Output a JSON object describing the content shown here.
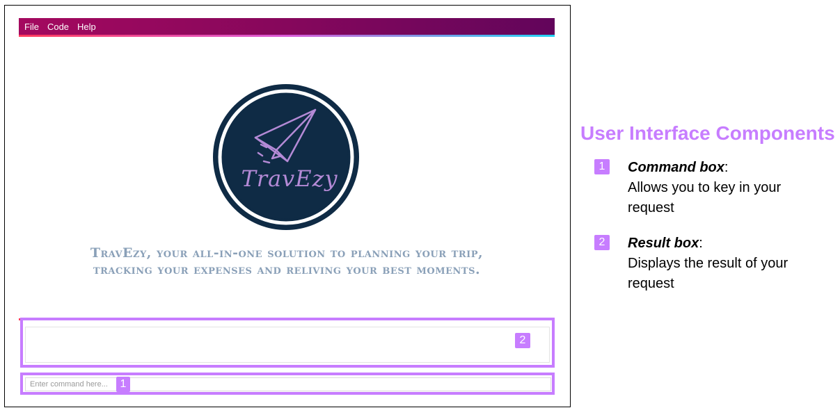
{
  "menu": [
    {
      "label": "File"
    },
    {
      "label": "Code"
    },
    {
      "label": "Help"
    }
  ],
  "logo": {
    "text": "TravEzy"
  },
  "tagline": {
    "line1": "TravEzy, your all-in-one solution to planning your trip,",
    "line2": "tracking your expenses and reliving your best moments."
  },
  "result_box": {
    "badge": "2",
    "content": ""
  },
  "command_box": {
    "placeholder": "Enter command here...",
    "value": "",
    "badge": "1"
  },
  "side_panel": {
    "title": "User Interface Components",
    "items": [
      {
        "badge": "1",
        "name": "Command box",
        "colon": ":",
        "desc_line1": "Allows you to key in your",
        "desc_line2": "request"
      },
      {
        "badge": "2",
        "name": "Result box",
        "colon": ":",
        "desc_line1": "Displays the result of your",
        "desc_line2": "request"
      }
    ]
  },
  "colors": {
    "accent": "#c77dff",
    "menu_start": "#a4095f",
    "menu_end": "#62055b",
    "logo_circle": "#0f2b45"
  }
}
